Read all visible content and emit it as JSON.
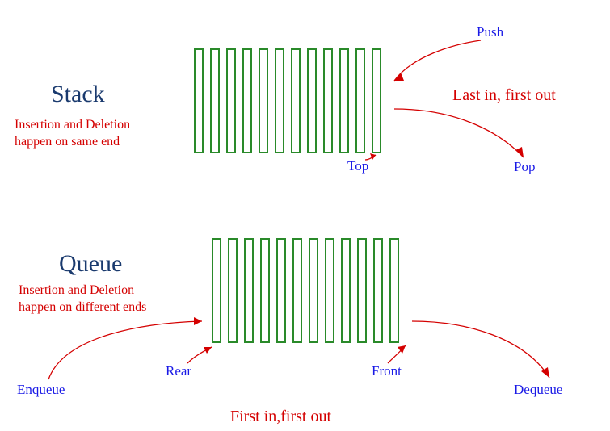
{
  "stack": {
    "title": "Stack",
    "caption": "Insertion and Deletion\nhappen on same end",
    "policy": "Last in, first out",
    "push_label": "Push",
    "pop_label": "Pop",
    "top_label": "Top",
    "bars": 12
  },
  "queue": {
    "title": "Queue",
    "caption": "Insertion and Deletion\nhappen on different ends",
    "policy": "First in,first out",
    "enqueue_label": "Enqueue",
    "dequeue_label": "Dequeue",
    "front_label": "Front",
    "rear_label": "Rear",
    "bars": 12
  }
}
